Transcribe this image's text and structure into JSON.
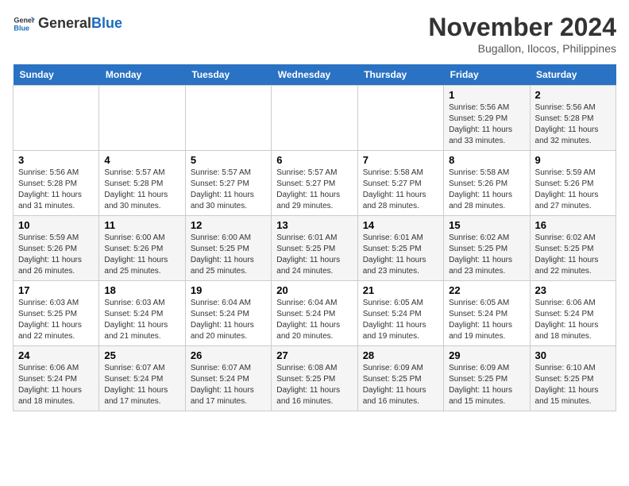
{
  "header": {
    "logo_general": "General",
    "logo_blue": "Blue",
    "month_year": "November 2024",
    "location": "Bugallon, Ilocos, Philippines"
  },
  "days_of_week": [
    "Sunday",
    "Monday",
    "Tuesday",
    "Wednesday",
    "Thursday",
    "Friday",
    "Saturday"
  ],
  "weeks": [
    [
      {
        "day": "",
        "info": ""
      },
      {
        "day": "",
        "info": ""
      },
      {
        "day": "",
        "info": ""
      },
      {
        "day": "",
        "info": ""
      },
      {
        "day": "",
        "info": ""
      },
      {
        "day": "1",
        "info": "Sunrise: 5:56 AM\nSunset: 5:29 PM\nDaylight: 11 hours and 33 minutes."
      },
      {
        "day": "2",
        "info": "Sunrise: 5:56 AM\nSunset: 5:28 PM\nDaylight: 11 hours and 32 minutes."
      }
    ],
    [
      {
        "day": "3",
        "info": "Sunrise: 5:56 AM\nSunset: 5:28 PM\nDaylight: 11 hours and 31 minutes."
      },
      {
        "day": "4",
        "info": "Sunrise: 5:57 AM\nSunset: 5:28 PM\nDaylight: 11 hours and 30 minutes."
      },
      {
        "day": "5",
        "info": "Sunrise: 5:57 AM\nSunset: 5:27 PM\nDaylight: 11 hours and 30 minutes."
      },
      {
        "day": "6",
        "info": "Sunrise: 5:57 AM\nSunset: 5:27 PM\nDaylight: 11 hours and 29 minutes."
      },
      {
        "day": "7",
        "info": "Sunrise: 5:58 AM\nSunset: 5:27 PM\nDaylight: 11 hours and 28 minutes."
      },
      {
        "day": "8",
        "info": "Sunrise: 5:58 AM\nSunset: 5:26 PM\nDaylight: 11 hours and 28 minutes."
      },
      {
        "day": "9",
        "info": "Sunrise: 5:59 AM\nSunset: 5:26 PM\nDaylight: 11 hours and 27 minutes."
      }
    ],
    [
      {
        "day": "10",
        "info": "Sunrise: 5:59 AM\nSunset: 5:26 PM\nDaylight: 11 hours and 26 minutes."
      },
      {
        "day": "11",
        "info": "Sunrise: 6:00 AM\nSunset: 5:26 PM\nDaylight: 11 hours and 25 minutes."
      },
      {
        "day": "12",
        "info": "Sunrise: 6:00 AM\nSunset: 5:25 PM\nDaylight: 11 hours and 25 minutes."
      },
      {
        "day": "13",
        "info": "Sunrise: 6:01 AM\nSunset: 5:25 PM\nDaylight: 11 hours and 24 minutes."
      },
      {
        "day": "14",
        "info": "Sunrise: 6:01 AM\nSunset: 5:25 PM\nDaylight: 11 hours and 23 minutes."
      },
      {
        "day": "15",
        "info": "Sunrise: 6:02 AM\nSunset: 5:25 PM\nDaylight: 11 hours and 23 minutes."
      },
      {
        "day": "16",
        "info": "Sunrise: 6:02 AM\nSunset: 5:25 PM\nDaylight: 11 hours and 22 minutes."
      }
    ],
    [
      {
        "day": "17",
        "info": "Sunrise: 6:03 AM\nSunset: 5:25 PM\nDaylight: 11 hours and 22 minutes."
      },
      {
        "day": "18",
        "info": "Sunrise: 6:03 AM\nSunset: 5:24 PM\nDaylight: 11 hours and 21 minutes."
      },
      {
        "day": "19",
        "info": "Sunrise: 6:04 AM\nSunset: 5:24 PM\nDaylight: 11 hours and 20 minutes."
      },
      {
        "day": "20",
        "info": "Sunrise: 6:04 AM\nSunset: 5:24 PM\nDaylight: 11 hours and 20 minutes."
      },
      {
        "day": "21",
        "info": "Sunrise: 6:05 AM\nSunset: 5:24 PM\nDaylight: 11 hours and 19 minutes."
      },
      {
        "day": "22",
        "info": "Sunrise: 6:05 AM\nSunset: 5:24 PM\nDaylight: 11 hours and 19 minutes."
      },
      {
        "day": "23",
        "info": "Sunrise: 6:06 AM\nSunset: 5:24 PM\nDaylight: 11 hours and 18 minutes."
      }
    ],
    [
      {
        "day": "24",
        "info": "Sunrise: 6:06 AM\nSunset: 5:24 PM\nDaylight: 11 hours and 18 minutes."
      },
      {
        "day": "25",
        "info": "Sunrise: 6:07 AM\nSunset: 5:24 PM\nDaylight: 11 hours and 17 minutes."
      },
      {
        "day": "26",
        "info": "Sunrise: 6:07 AM\nSunset: 5:24 PM\nDaylight: 11 hours and 17 minutes."
      },
      {
        "day": "27",
        "info": "Sunrise: 6:08 AM\nSunset: 5:25 PM\nDaylight: 11 hours and 16 minutes."
      },
      {
        "day": "28",
        "info": "Sunrise: 6:09 AM\nSunset: 5:25 PM\nDaylight: 11 hours and 16 minutes."
      },
      {
        "day": "29",
        "info": "Sunrise: 6:09 AM\nSunset: 5:25 PM\nDaylight: 11 hours and 15 minutes."
      },
      {
        "day": "30",
        "info": "Sunrise: 6:10 AM\nSunset: 5:25 PM\nDaylight: 11 hours and 15 minutes."
      }
    ]
  ]
}
